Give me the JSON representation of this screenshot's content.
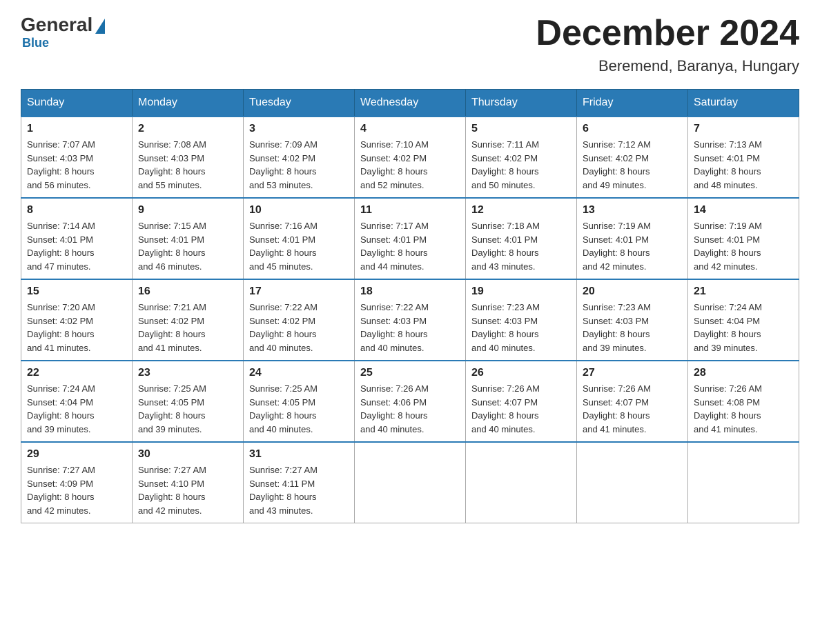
{
  "header": {
    "logo": {
      "general": "General",
      "blue": "Blue"
    },
    "title": "December 2024",
    "location": "Beremend, Baranya, Hungary"
  },
  "calendar": {
    "days_of_week": [
      "Sunday",
      "Monday",
      "Tuesday",
      "Wednesday",
      "Thursday",
      "Friday",
      "Saturday"
    ],
    "weeks": [
      [
        {
          "day": "1",
          "sunrise": "7:07 AM",
          "sunset": "4:03 PM",
          "daylight": "8 hours and 56 minutes."
        },
        {
          "day": "2",
          "sunrise": "7:08 AM",
          "sunset": "4:03 PM",
          "daylight": "8 hours and 55 minutes."
        },
        {
          "day": "3",
          "sunrise": "7:09 AM",
          "sunset": "4:02 PM",
          "daylight": "8 hours and 53 minutes."
        },
        {
          "day": "4",
          "sunrise": "7:10 AM",
          "sunset": "4:02 PM",
          "daylight": "8 hours and 52 minutes."
        },
        {
          "day": "5",
          "sunrise": "7:11 AM",
          "sunset": "4:02 PM",
          "daylight": "8 hours and 50 minutes."
        },
        {
          "day": "6",
          "sunrise": "7:12 AM",
          "sunset": "4:02 PM",
          "daylight": "8 hours and 49 minutes."
        },
        {
          "day": "7",
          "sunrise": "7:13 AM",
          "sunset": "4:01 PM",
          "daylight": "8 hours and 48 minutes."
        }
      ],
      [
        {
          "day": "8",
          "sunrise": "7:14 AM",
          "sunset": "4:01 PM",
          "daylight": "8 hours and 47 minutes."
        },
        {
          "day": "9",
          "sunrise": "7:15 AM",
          "sunset": "4:01 PM",
          "daylight": "8 hours and 46 minutes."
        },
        {
          "day": "10",
          "sunrise": "7:16 AM",
          "sunset": "4:01 PM",
          "daylight": "8 hours and 45 minutes."
        },
        {
          "day": "11",
          "sunrise": "7:17 AM",
          "sunset": "4:01 PM",
          "daylight": "8 hours and 44 minutes."
        },
        {
          "day": "12",
          "sunrise": "7:18 AM",
          "sunset": "4:01 PM",
          "daylight": "8 hours and 43 minutes."
        },
        {
          "day": "13",
          "sunrise": "7:19 AM",
          "sunset": "4:01 PM",
          "daylight": "8 hours and 42 minutes."
        },
        {
          "day": "14",
          "sunrise": "7:19 AM",
          "sunset": "4:01 PM",
          "daylight": "8 hours and 42 minutes."
        }
      ],
      [
        {
          "day": "15",
          "sunrise": "7:20 AM",
          "sunset": "4:02 PM",
          "daylight": "8 hours and 41 minutes."
        },
        {
          "day": "16",
          "sunrise": "7:21 AM",
          "sunset": "4:02 PM",
          "daylight": "8 hours and 41 minutes."
        },
        {
          "day": "17",
          "sunrise": "7:22 AM",
          "sunset": "4:02 PM",
          "daylight": "8 hours and 40 minutes."
        },
        {
          "day": "18",
          "sunrise": "7:22 AM",
          "sunset": "4:03 PM",
          "daylight": "8 hours and 40 minutes."
        },
        {
          "day": "19",
          "sunrise": "7:23 AM",
          "sunset": "4:03 PM",
          "daylight": "8 hours and 40 minutes."
        },
        {
          "day": "20",
          "sunrise": "7:23 AM",
          "sunset": "4:03 PM",
          "daylight": "8 hours and 39 minutes."
        },
        {
          "day": "21",
          "sunrise": "7:24 AM",
          "sunset": "4:04 PM",
          "daylight": "8 hours and 39 minutes."
        }
      ],
      [
        {
          "day": "22",
          "sunrise": "7:24 AM",
          "sunset": "4:04 PM",
          "daylight": "8 hours and 39 minutes."
        },
        {
          "day": "23",
          "sunrise": "7:25 AM",
          "sunset": "4:05 PM",
          "daylight": "8 hours and 39 minutes."
        },
        {
          "day": "24",
          "sunrise": "7:25 AM",
          "sunset": "4:05 PM",
          "daylight": "8 hours and 40 minutes."
        },
        {
          "day": "25",
          "sunrise": "7:26 AM",
          "sunset": "4:06 PM",
          "daylight": "8 hours and 40 minutes."
        },
        {
          "day": "26",
          "sunrise": "7:26 AM",
          "sunset": "4:07 PM",
          "daylight": "8 hours and 40 minutes."
        },
        {
          "day": "27",
          "sunrise": "7:26 AM",
          "sunset": "4:07 PM",
          "daylight": "8 hours and 41 minutes."
        },
        {
          "day": "28",
          "sunrise": "7:26 AM",
          "sunset": "4:08 PM",
          "daylight": "8 hours and 41 minutes."
        }
      ],
      [
        {
          "day": "29",
          "sunrise": "7:27 AM",
          "sunset": "4:09 PM",
          "daylight": "8 hours and 42 minutes."
        },
        {
          "day": "30",
          "sunrise": "7:27 AM",
          "sunset": "4:10 PM",
          "daylight": "8 hours and 42 minutes."
        },
        {
          "day": "31",
          "sunrise": "7:27 AM",
          "sunset": "4:11 PM",
          "daylight": "8 hours and 43 minutes."
        },
        null,
        null,
        null,
        null
      ]
    ]
  }
}
